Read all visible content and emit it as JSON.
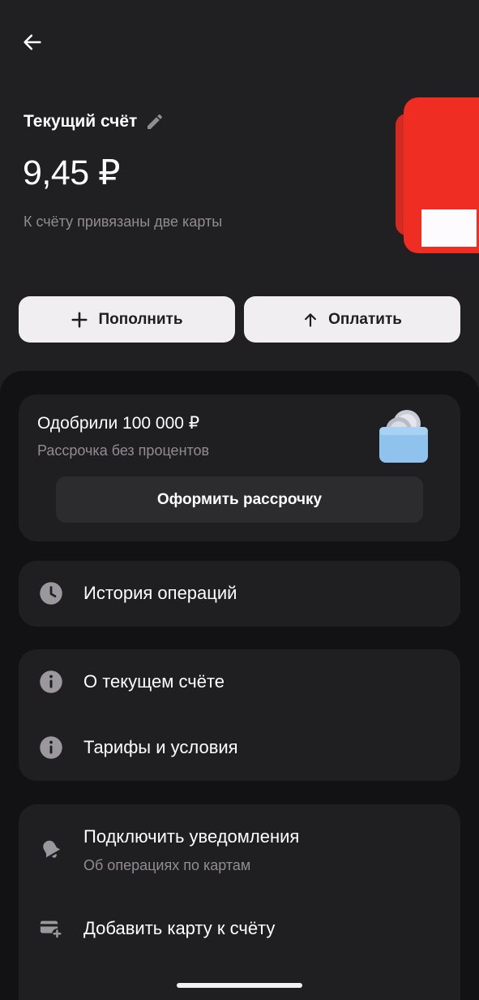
{
  "header": {
    "back_icon": "arrow-left-icon"
  },
  "account": {
    "title": "Текущий счёт",
    "edit_icon": "pencil-icon",
    "balance": "9,45 ₽",
    "cards_note": "К счёту привязаны две карты"
  },
  "actions": {
    "topup_label": "Пополнить",
    "topup_icon": "plus-icon",
    "pay_label": "Оплатить",
    "pay_icon": "arrow-up-icon"
  },
  "promo": {
    "title": "Одобрили 100 000 ₽",
    "subtitle": "Рассрочка без процентов",
    "button_label": "Оформить рассрочку",
    "icon": "wallet-coins-icon"
  },
  "menu": {
    "history": {
      "label": "История операций",
      "icon": "clock-icon"
    },
    "about": {
      "label": "О текущем счёте",
      "icon": "info-icon"
    },
    "tariffs": {
      "label": "Тарифы и условия",
      "icon": "info-icon"
    },
    "notifications": {
      "label": "Подключить уведомления",
      "sublabel": "Об операциях по картам",
      "icon": "bell-icon"
    },
    "add_card": {
      "label": "Добавить карту к счёту",
      "icon": "card-add-icon"
    }
  },
  "colors": {
    "background": "#201f21",
    "sheet": "#121113",
    "panel": "#1f1e21",
    "button_light": "#f1eef2",
    "card_red": "#ef2d22",
    "muted_text": "#8f8d92"
  }
}
